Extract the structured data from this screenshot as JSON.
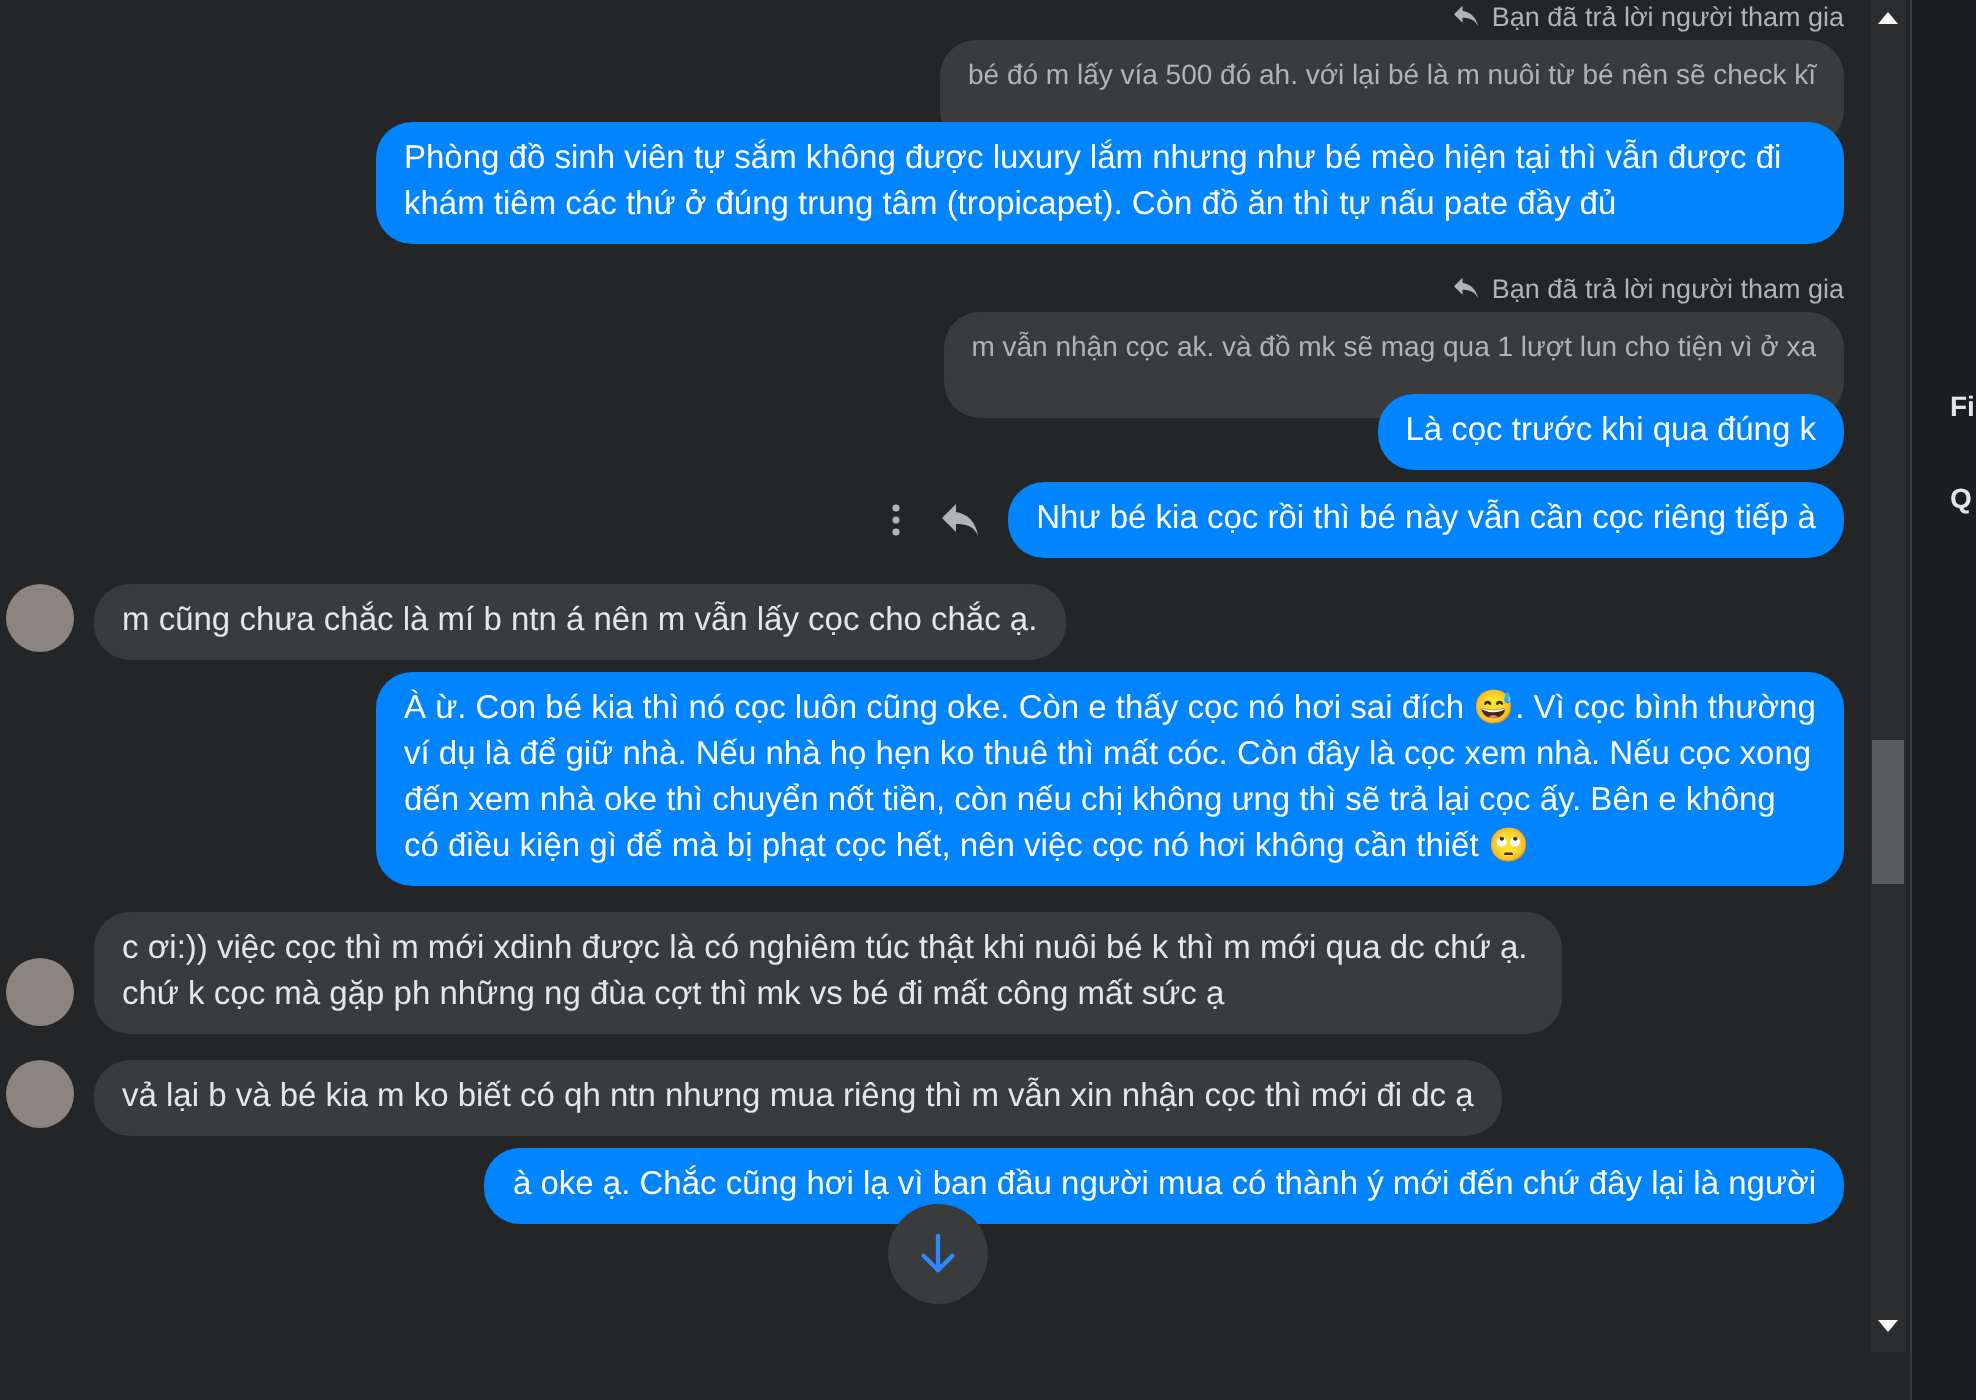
{
  "messages": [
    {
      "kind": "reply_label",
      "text": "Bạn đã trả lời người tham gia"
    },
    {
      "kind": "quoted",
      "text": "bé đó m lấy vía 500 đó ah. với lại bé là m nuôi từ bé nên sẽ check kĩ"
    },
    {
      "kind": "sent",
      "text": "Phòng đồ sinh viên tự sắm không được luxury lắm nhưng như bé mèo hiện tại thì vẫn được đi khám tiêm các thứ ở đúng trung tâm (tropicapet). Còn đồ ăn thì tự nấu pate đầy đủ",
      "hover_actions": false
    },
    {
      "kind": "reply_label",
      "text": "Bạn đã trả lời người tham gia"
    },
    {
      "kind": "quoted",
      "text": "m vẫn nhận cọc ak. và đồ mk sẽ mag qua 1 lượt lun cho tiện vì ở xa"
    },
    {
      "kind": "sent",
      "text": "Là cọc trước khi qua đúng k",
      "hover_actions": false
    },
    {
      "kind": "sent",
      "text": "Như bé kia cọc rồi thì bé này vẫn cần cọc riêng tiếp à",
      "hover_actions": true
    },
    {
      "kind": "received",
      "text": "m cũng chưa chắc là mí b ntn á nên m vẫn lấy cọc cho chắc ạ."
    },
    {
      "kind": "sent",
      "text": "À ừ. Con bé kia thì nó cọc luôn cũng oke. Còn e thấy cọc nó hơi sai đích 😅. Vì cọc bình thường ví dụ là để giữ nhà. Nếu nhà họ hẹn ko thuê thì mất cóc. Còn đây là cọc xem nhà. Nếu cọc xong đến xem nhà oke thì chuyển nốt tiền, còn nếu chị không ưng thì sẽ trả lại cọc ấy. Bên e không có điều kiện gì để mà bị phạt cọc hết, nên việc cọc nó hơi không cần thiết 🙄",
      "hover_actions": false
    },
    {
      "kind": "received",
      "text": "c ơi:)) việc cọc thì m mới xdinh được là có nghiêm túc thật khi nuôi bé k thì m mới qua dc chứ ạ. chứ k cọc mà gặp ph những ng đùa cợt thì mk vs bé đi mất công mất sức ạ"
    },
    {
      "kind": "received",
      "text": "vả lại b và bé kia m ko biết có qh ntn nhưng mua riêng thì m vẫn xin nhận cọc thì mới đi dc ạ"
    },
    {
      "kind": "sent",
      "text": "à oke ạ. Chắc cũng hơi lạ vì ban đầu người mua có thành ý mới đến chứ đây lại là người",
      "hover_actions": false
    }
  ],
  "side_panel": {
    "items": [
      "Fi",
      "Q"
    ]
  }
}
